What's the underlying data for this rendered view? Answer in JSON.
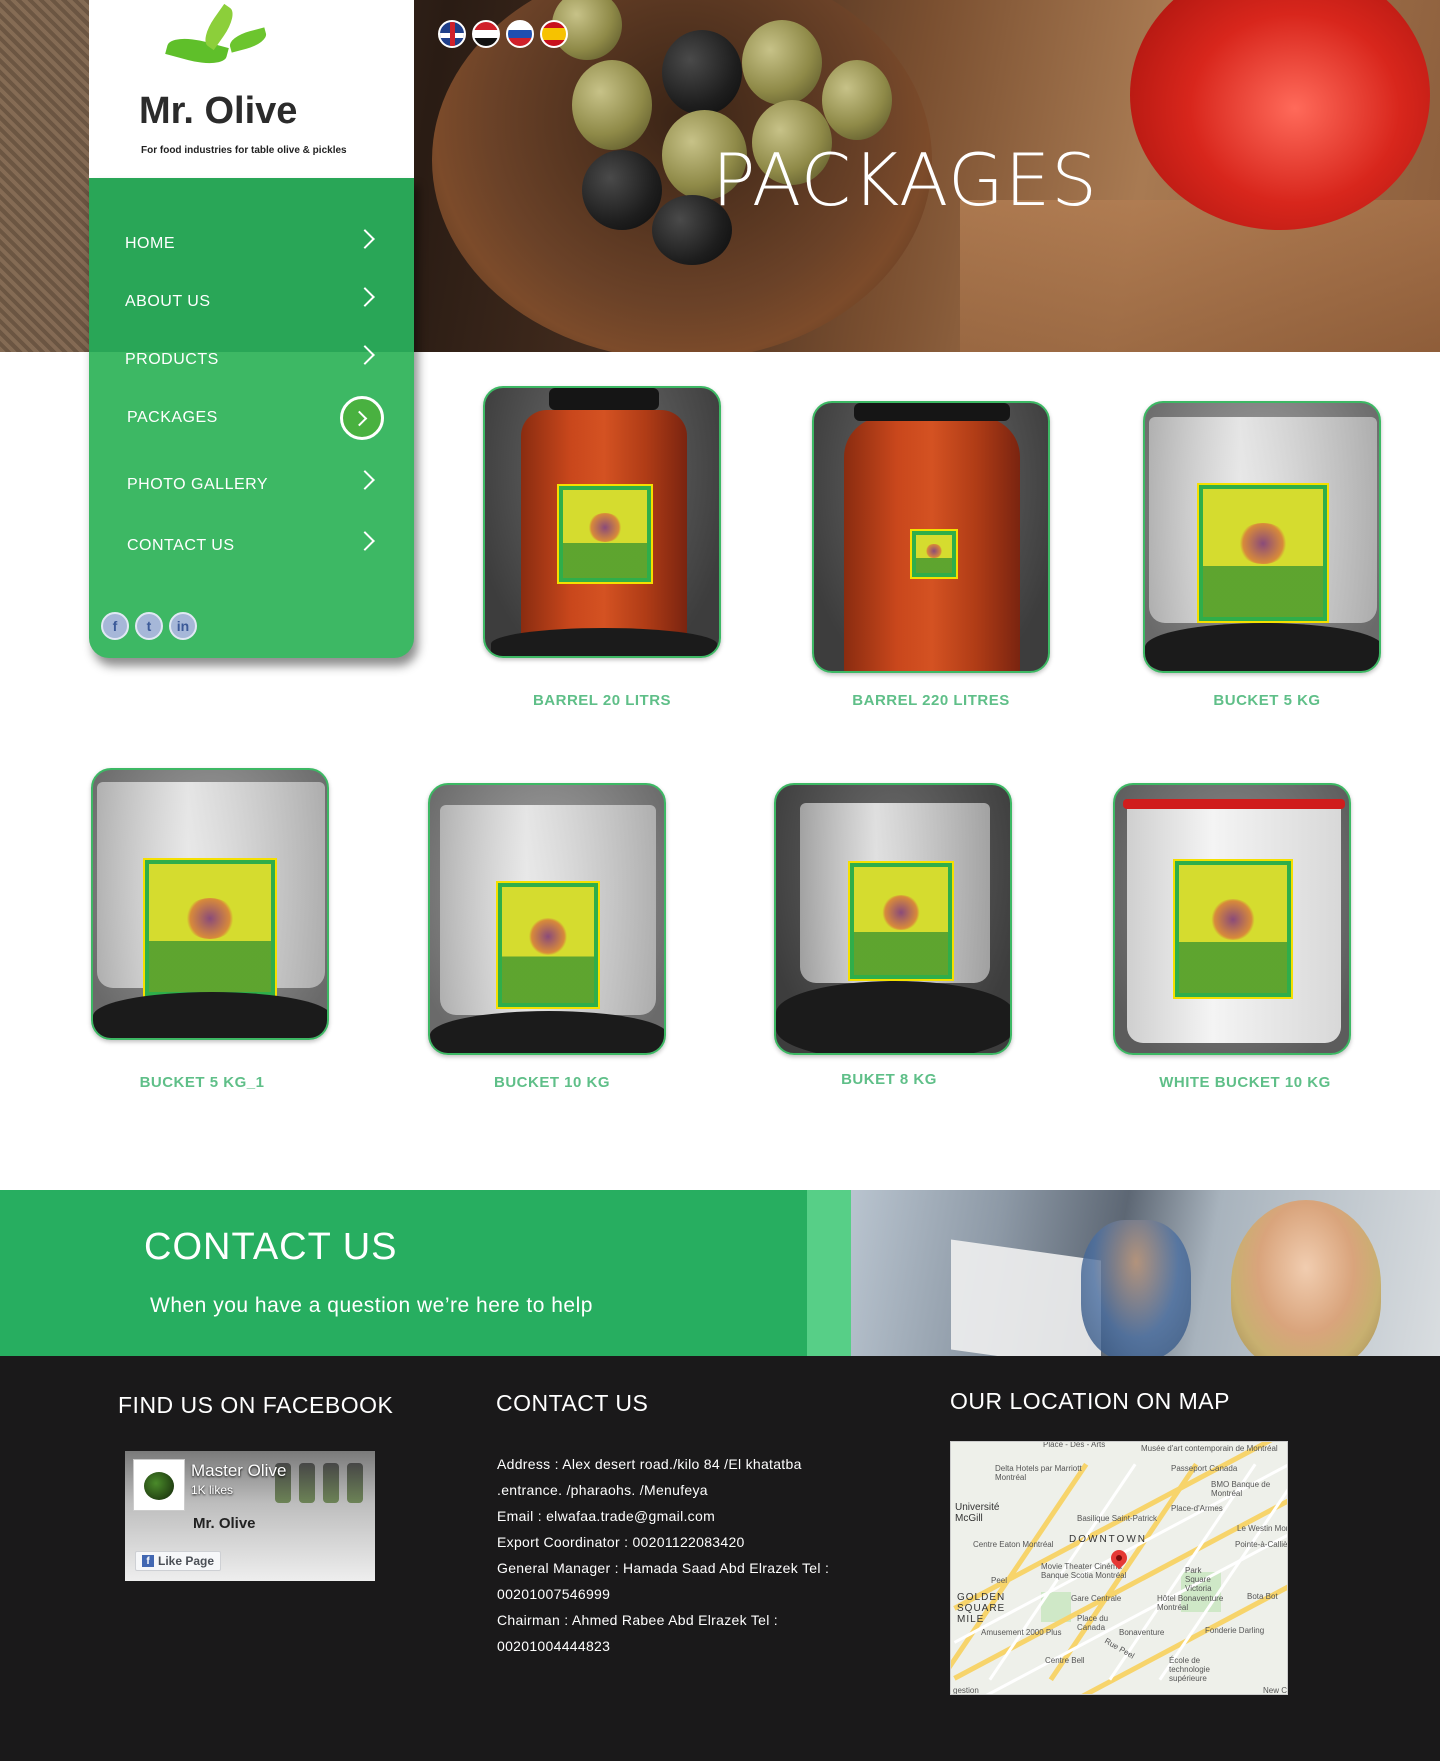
{
  "brand": {
    "logo_name": "Mr. Olive",
    "tagline": "For food industries for table olive & pickles"
  },
  "languages": [
    "english-flag-icon",
    "egypt-flag-icon",
    "russia-flag-icon",
    "spain-flag-icon"
  ],
  "hero": {
    "title": "PACKAGES"
  },
  "nav": {
    "items": [
      {
        "label": "HOME"
      },
      {
        "label": "ABOUT US"
      },
      {
        "label": "PRODUCTS"
      },
      {
        "label": "PACKAGES",
        "active": true
      },
      {
        "label": "PHOTO GALLERY"
      },
      {
        "label": "CONTACT US"
      }
    ],
    "social": [
      "facebook-icon",
      "twitter-icon",
      "linkedin-icon"
    ]
  },
  "products": [
    {
      "name": "BARREL 20 LITRS"
    },
    {
      "name": "BARREL 220 LITRES"
    },
    {
      "name": "BUCKET 5 KG"
    },
    {
      "name": "BUCKET 5 KG_1"
    },
    {
      "name": "BUCKET 10 KG"
    },
    {
      "name": "BUKET 8 KG"
    },
    {
      "name": "WHITE BUCKET 10 KG"
    }
  ],
  "contact_band": {
    "title": "CONTACT US",
    "subtitle": "When you have a question we’re here to help"
  },
  "footer": {
    "facebook_heading": "FIND US ON FACEBOOK",
    "fb_widget": {
      "page_name": "Master Olive",
      "likes": "1K likes",
      "logo_text": "Mr. Olive",
      "like_button": "Like Page"
    },
    "contact_heading": "CONTACT US",
    "contact_lines": [
      "Address :  Alex desert road./kilo 84 /El khatatba",
      ".entrance. /pharaohs. /Menufeya",
      "Email : elwafaa.trade@gmail.com",
      "Export Coordinator : 00201122083420",
      "General Manager : Hamada Saad Abd Elrazek   Tel :",
      "00201007546999",
      "Chairman :  Ahmed Rabee Abd Elrazek  Tel :",
      "00201004444823"
    ],
    "map_heading": "OUR LOCATION ON MAP",
    "map_labels": {
      "l1": "Place - Des - Arts",
      "l2": "Musée d'art contemporain de Montréal",
      "l3": "Delta Hotels par Marriott Montréal",
      "l4": "Passeport Canada",
      "l5": "BMO Banque de Montréal",
      "l6": "Université McGill",
      "l7": "Basilique Saint-Patrick",
      "l8": "Place-d'Armes",
      "l9": "Centre Eaton Montréal",
      "l10": "DOWNTOWN",
      "l11": "Le Westin Mont",
      "l12": "Pointe-à-Calliè",
      "l13": "Movie Theater Cinéma Banque Scotia Montréal",
      "l14": "Peel",
      "l15": "Park Square Victoria",
      "l16": "Gare Centrale",
      "l17": "Bota Bot",
      "l18": "GOLDEN SQUARE MILE",
      "l19": "Place du Canada",
      "l20": "Hôtel Bonaventure Montréal",
      "l21": "Amusement 2000 Plus",
      "l22": "Bonaventure",
      "l23": "Fonderie Darling",
      "l24": "Centre Bell",
      "l25": "École de technologie supérieure",
      "l26": "Rue Peel",
      "l27": "New C",
      "l28": "gestion"
    }
  }
}
